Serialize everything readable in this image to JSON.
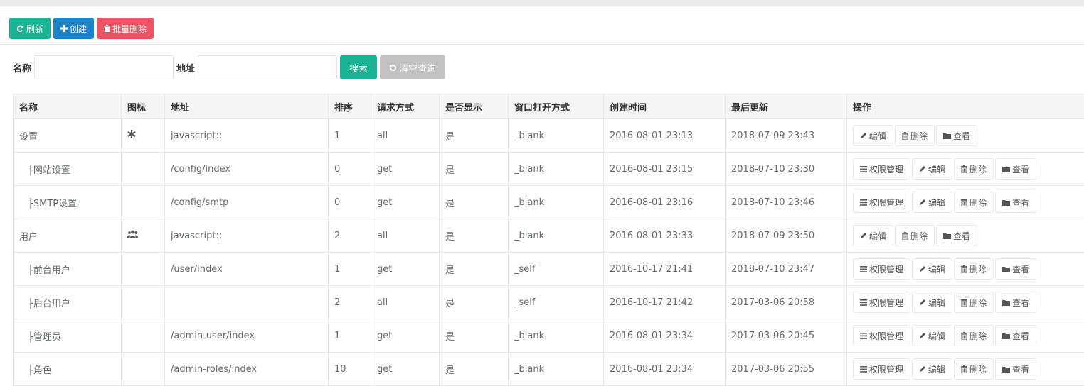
{
  "toolbar": {
    "refresh_label": "刷新",
    "create_label": "创建",
    "batch_delete_label": "批量删除"
  },
  "search": {
    "name_label": "名称",
    "name_value": "",
    "address_label": "地址",
    "address_value": "",
    "search_label": "搜索",
    "clear_label": "清空查询"
  },
  "table": {
    "headers": [
      "名称",
      "图标",
      "地址",
      "排序",
      "请求方式",
      "是否显示",
      "窗口打开方式",
      "创建时间",
      "最后更新",
      "操作"
    ],
    "ops_labels": {
      "permissions": "权限管理",
      "edit": "编辑",
      "delete": "删除",
      "view": "查看"
    },
    "rows": [
      {
        "name": "设置",
        "icon": "asterisk-icon",
        "address": "javascript:;",
        "sort": "1",
        "method": "all",
        "visible": "是",
        "target": "_blank",
        "created": "2016-08-01 23:13",
        "updated": "2018-07-09 23:43"
      },
      {
        "name": "├网站设置",
        "icon": "",
        "address": "/config/index",
        "sort": "0",
        "method": "get",
        "visible": "是",
        "target": "_blank",
        "created": "2016-08-01 23:15",
        "updated": "2018-07-10 23:30"
      },
      {
        "name": "├SMTP设置",
        "icon": "",
        "address": "/config/smtp",
        "sort": "0",
        "method": "get",
        "visible": "是",
        "target": "_blank",
        "created": "2016-08-01 23:16",
        "updated": "2018-07-10 23:46"
      },
      {
        "name": "用户",
        "icon": "users-icon",
        "address": "javascript:;",
        "sort": "2",
        "method": "all",
        "visible": "是",
        "target": "_blank",
        "created": "2016-08-01 23:33",
        "updated": "2018-07-09 23:50"
      },
      {
        "name": "├前台用户",
        "icon": "",
        "address": "/user/index",
        "sort": "1",
        "method": "get",
        "visible": "是",
        "target": "_self",
        "created": "2016-10-17 21:41",
        "updated": "2018-07-10 23:47"
      },
      {
        "name": "├后台用户",
        "icon": "",
        "address": "",
        "sort": "2",
        "method": "all",
        "visible": "是",
        "target": "_self",
        "created": "2016-10-17 21:42",
        "updated": "2017-03-06 20:58"
      },
      {
        "name": "├管理员",
        "icon": "",
        "address": "/admin-user/index",
        "sort": "1",
        "method": "get",
        "visible": "是",
        "target": "_blank",
        "created": "2016-08-01 23:34",
        "updated": "2017-03-06 20:45"
      },
      {
        "name": "├角色",
        "icon": "",
        "address": "/admin-roles/index",
        "sort": "10",
        "method": "get",
        "visible": "是",
        "target": "_blank",
        "created": "2016-08-01 23:34",
        "updated": "2017-03-06 20:55"
      }
    ]
  },
  "colors": {
    "teal": "#1ab394",
    "blue": "#1c84c6",
    "red": "#ed5565",
    "gray": "#c2c2c2"
  }
}
